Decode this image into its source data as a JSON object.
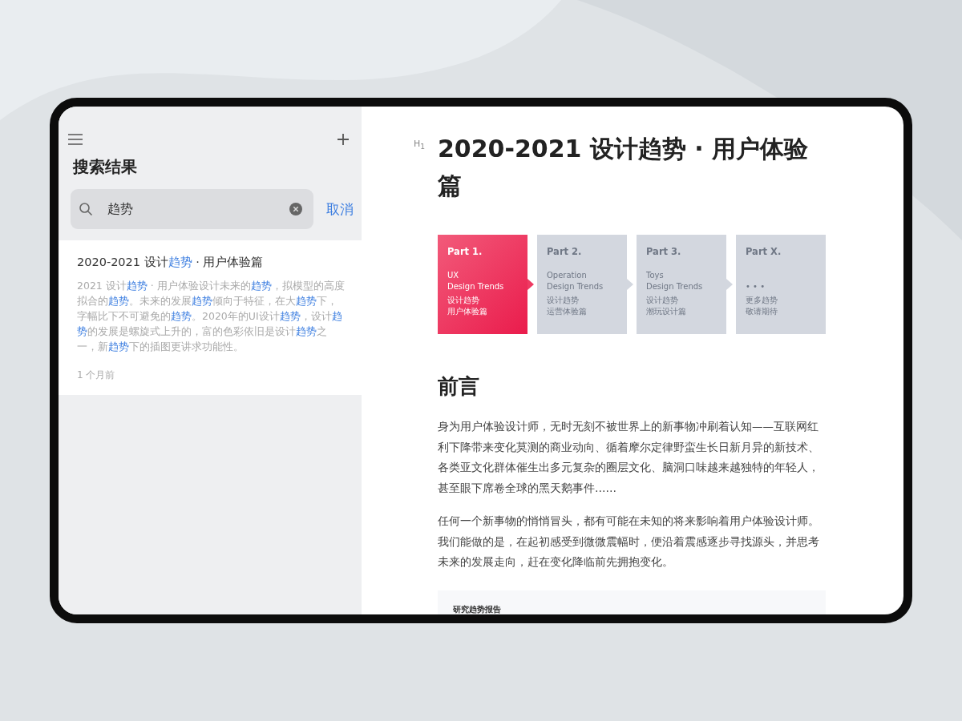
{
  "sidebar": {
    "title": "搜索结果",
    "search": {
      "value": "趋势"
    },
    "cancel": "取消",
    "results": [
      {
        "title": [
          {
            "text": "2020-2021 设计",
            "highlight": false
          },
          {
            "text": "趋势",
            "highlight": true
          },
          {
            "text": " · 用户体验篇",
            "highlight": false
          }
        ],
        "snippet": [
          {
            "text": "2021 设计",
            "highlight": false
          },
          {
            "text": "趋势",
            "highlight": true
          },
          {
            "text": " · 用户体验设计未来的",
            "highlight": false
          },
          {
            "text": "趋势",
            "highlight": true
          },
          {
            "text": "，拟模型的高度拟合的",
            "highlight": false
          },
          {
            "text": "趋势",
            "highlight": true
          },
          {
            "text": "。未来的发展",
            "highlight": false
          },
          {
            "text": "趋势",
            "highlight": true
          },
          {
            "text": "倾向于特征，在大",
            "highlight": false
          },
          {
            "text": "趋势",
            "highlight": true
          },
          {
            "text": "下，字幅比下不可避免的",
            "highlight": false
          },
          {
            "text": "趋势",
            "highlight": true
          },
          {
            "text": "。2020年的UI设计",
            "highlight": false
          },
          {
            "text": "趋势",
            "highlight": true
          },
          {
            "text": "，设计",
            "highlight": false
          },
          {
            "text": "趋势",
            "highlight": true
          },
          {
            "text": "的发展是螺旋式上升的，富的色彩依旧是设计",
            "highlight": false
          },
          {
            "text": "趋势",
            "highlight": true
          },
          {
            "text": "之一，新",
            "highlight": false
          },
          {
            "text": "趋势",
            "highlight": true
          },
          {
            "text": "下的插图更讲求功能性。",
            "highlight": false
          }
        ],
        "time": "1 个月前"
      }
    ]
  },
  "document": {
    "heading_marker": "H$_{1}$",
    "title": "2020-2021 设计趋势 · 用户体验篇",
    "parts": [
      {
        "title": "Part 1.",
        "lines": [
          "UX",
          "Design Trends"
        ],
        "cn": [
          "设计趋势",
          "用户体验篇"
        ],
        "selected": true
      },
      {
        "title": "Part 2.",
        "lines": [
          "Operation",
          "Design Trends"
        ],
        "cn": [
          "设计趋势",
          "运营体验篇"
        ],
        "selected": false
      },
      {
        "title": "Part 3.",
        "lines": [
          "Toys",
          "Design Trends"
        ],
        "cn": [
          "设计趋势",
          "潮玩设计篇"
        ],
        "selected": false
      },
      {
        "title": "Part X.",
        "lines": [
          "• • •"
        ],
        "cn": [
          "更多趋势",
          "敬请期待"
        ],
        "selected": false
      }
    ],
    "section_heading": "前言",
    "paragraphs": [
      "身为用户体验设计师，无时无刻不被世界上的新事物冲刷着认知——互联网红利下降带来变化莫测的商业动向、循着摩尔定律野蛮生长日新月异的新技术、各类亚文化群体催生出多元复杂的圈层文化、脑洞口味越来越独特的年轻人，甚至眼下席卷全球的黑天鹅事件……",
      "任何一个新事物的悄悄冒头，都有可能在未知的将来影响着用户体验设计师。我们能做的是，在起初感受到微微震幅时，便沿着震感逐步寻找源头，并思考未来的发展走向，赶在变化降临前先拥抱变化。"
    ],
    "quote": "研究趋势报告"
  }
}
